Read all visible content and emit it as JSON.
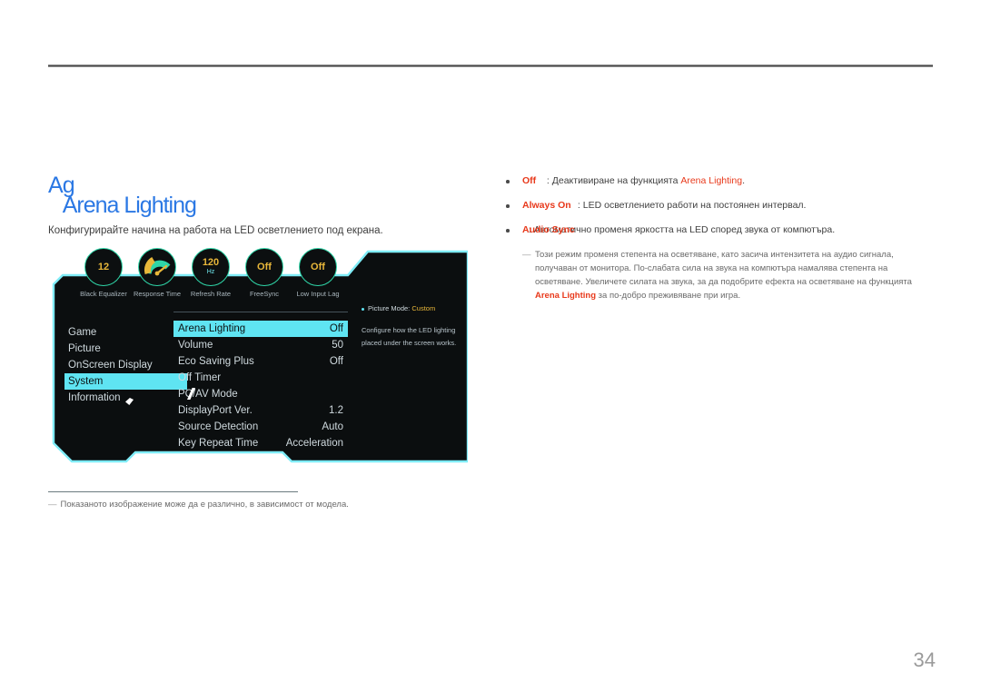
{
  "page": {
    "number": "34",
    "title_text": "Arena Lighting",
    "title_color": "#2b78e4",
    "accent_cyan": "#5fe4f2",
    "accent_red": "#e8391b",
    "accent_amber": "#e8b73a"
  },
  "intro": {
    "lead": "Конфигурирайте начина на работа на LED осветлението под екрана."
  },
  "osd": {
    "header_icons": [
      {
        "label": "Black Equalizer",
        "value": "12",
        "unit": ""
      },
      {
        "label": "Response Time",
        "value": "",
        "unit": ""
      },
      {
        "label": "Refresh Rate",
        "value": "120",
        "unit": "Hz"
      },
      {
        "label": "FreeSync",
        "value": "Off",
        "unit": ""
      },
      {
        "label": "Low Input Lag",
        "value": "Off",
        "unit": ""
      }
    ],
    "left_menu": [
      {
        "label": "Game",
        "selected": false
      },
      {
        "label": "Picture",
        "selected": false
      },
      {
        "label": "OnScreen Display",
        "selected": false
      },
      {
        "label": "System",
        "selected": true
      },
      {
        "label": "Information",
        "selected": false
      }
    ],
    "options": [
      {
        "label": "Arena Lighting",
        "value": "Off",
        "selected": true
      },
      {
        "label": "Volume",
        "value": "50",
        "selected": false
      },
      {
        "label": "Eco Saving Plus",
        "value": "Off",
        "selected": false
      },
      {
        "label": "Off Timer",
        "value": "",
        "selected": false
      },
      {
        "label": "PC/AV Mode",
        "value": "",
        "selected": false
      },
      {
        "label": "DisplayPort Ver.",
        "value": "1.2",
        "selected": false
      },
      {
        "label": "Source Detection",
        "value": "Auto",
        "selected": false
      },
      {
        "label": "Key Repeat Time",
        "value": "Acceleration",
        "selected": false
      }
    ],
    "description": {
      "picture_mode_label": "Picture Mode:",
      "picture_mode_value": "Custom",
      "line1": "Configure how the LED lighting",
      "line2": "placed under the screen works."
    }
  },
  "footnote": {
    "dash": "―",
    "text": "Показаното изображение може да е различно, в зависимост от модела."
  },
  "bullets": [
    {
      "tag": "Off",
      "text_before": ": Деактивиране на функцията ",
      "highlight": "Arena Lighting",
      "text_after": "."
    },
    {
      "tag": "Always On",
      "text_before": ": LED осветлението работи на постоянен интервал.",
      "highlight": "",
      "text_after": ""
    },
    {
      "tag": "Audio Sync",
      "text_before": ": Автоматично променя яркостта на LED според звука от компютъра.",
      "highlight": "",
      "text_after": ""
    }
  ],
  "note": {
    "dash": "―",
    "part1": "Този режим променя степента на осветяване, като засича интензитета на аудио сигнала, получаван от монитора. По-слабата сила на звука на компютъра намалява степента на осветяване. Увеличете силата на звука, за да подобрите ефекта на осветяване на функцията ",
    "highlight": "Arena Lighting",
    "part2": " за по-добро преживяване при игра."
  }
}
